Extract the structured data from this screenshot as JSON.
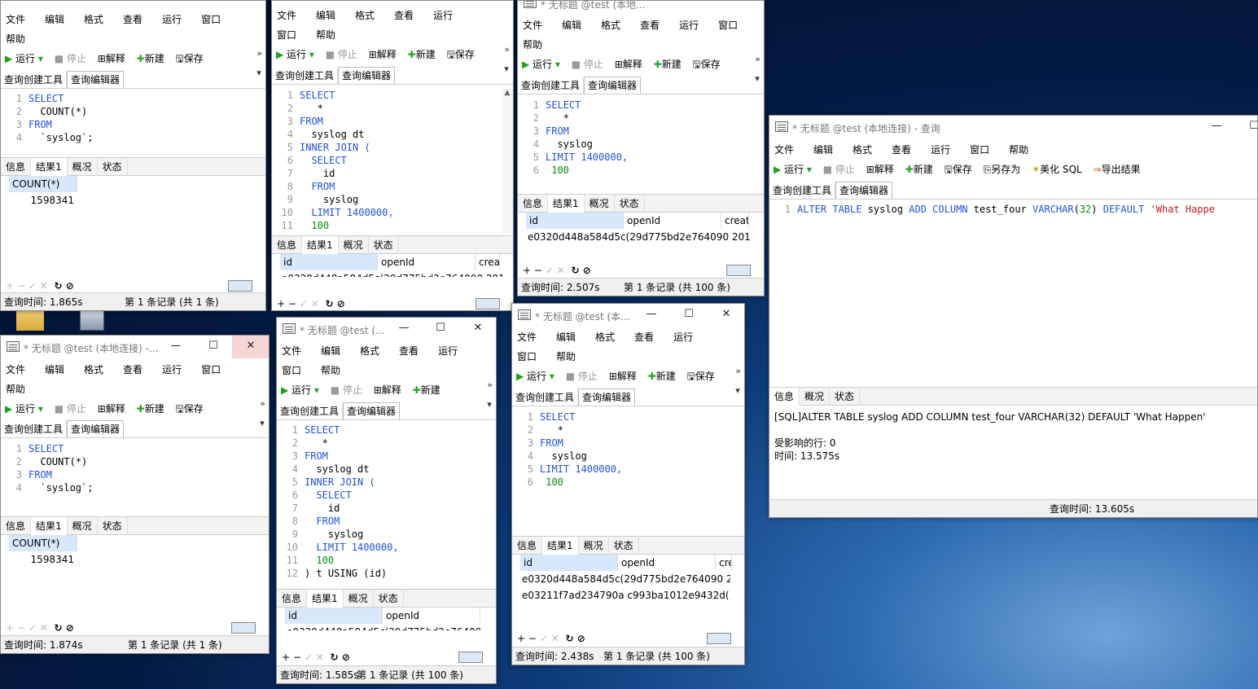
{
  "menus_a": [
    "文件",
    "编辑",
    "格式",
    "查看",
    "运行",
    "窗口",
    "帮助"
  ],
  "toolbar_a": {
    "run": "运行",
    "stop": "停止",
    "explain": "解释",
    "new": "新建",
    "save": "保存"
  },
  "toolbar_e": {
    "run": "运行",
    "stop": "停止",
    "explain": "解释",
    "new": "新建",
    "save": "保存",
    "saveas": "另存为",
    "beautify": "美化 SQL",
    "export": "导出结果"
  },
  "tabs": {
    "builder": "查询创建工具",
    "editor": "查询编辑器"
  },
  "result_tabs": {
    "info": "信息",
    "result1": "结果1",
    "profile": "概况",
    "status": "状态"
  },
  "win_count": {
    "code": [
      {
        "n": "1",
        "a": "SELECT",
        "b": ""
      },
      {
        "n": "2",
        "a": "",
        "b": "  COUNT(*)"
      },
      {
        "n": "3",
        "a": "FROM",
        "b": ""
      },
      {
        "n": "4",
        "a": "",
        "b": "  `syslog`;"
      }
    ],
    "col": "COUNT(*)",
    "val": "1598341"
  },
  "win1": {
    "title": "",
    "time": "查询时间: 1.865s",
    "records": "第 1 条记录 (共 1 条)"
  },
  "win2": {
    "title": "* 无标题 @test (本地连接) -...",
    "time": "查询时间: 1.874s",
    "records": "第 1 条记录 (共 1 条)"
  },
  "win3": {
    "code": [
      {
        "n": "1",
        "t": "SELECT"
      },
      {
        "n": "2",
        "t": "   *"
      },
      {
        "n": "3",
        "t": "FROM"
      },
      {
        "n": "4",
        "t": "  syslog dt"
      },
      {
        "n": "5",
        "t": "INNER JOIN ("
      },
      {
        "n": "6",
        "t": "  SELECT"
      },
      {
        "n": "7",
        "t": "    id"
      },
      {
        "n": "8",
        "t": "  FROM"
      },
      {
        "n": "9",
        "t": "    syslog"
      },
      {
        "n": "10",
        "t": "  LIMIT 1400000,"
      },
      {
        "n": "11",
        "t": "  100"
      }
    ],
    "cols": [
      "id",
      "openId",
      "crea"
    ],
    "row": "e0320d448a584d5c(29d775bd2e764090 2019"
  },
  "win4": {
    "title": "* 无标题 @test (...",
    "code": [
      {
        "n": "1",
        "t": "SELECT"
      },
      {
        "n": "2",
        "t": "   *"
      },
      {
        "n": "3",
        "t": "FROM"
      },
      {
        "n": "4",
        "t": "  syslog dt"
      },
      {
        "n": "5",
        "t": "INNER JOIN ("
      },
      {
        "n": "6",
        "t": "  SELECT"
      },
      {
        "n": "7",
        "t": "    id"
      },
      {
        "n": "8",
        "t": "  FROM"
      },
      {
        "n": "9",
        "t": "    syslog"
      },
      {
        "n": "10",
        "t": "  LIMIT 1400000,"
      },
      {
        "n": "11",
        "t": "  100"
      },
      {
        "n": "12",
        "t": ") t USING (id)"
      }
    ],
    "cols": [
      "id",
      "openId"
    ],
    "row": "e0320d448a584d5c(29d775bd2e764090",
    "time": "查询时间: 1.585s",
    "records": "第 1 条记录 (共 100 条)"
  },
  "win5": {
    "title": "* 无标题 @test (本地...",
    "code": [
      {
        "n": "1",
        "t": "SELECT"
      },
      {
        "n": "2",
        "t": "   *"
      },
      {
        "n": "3",
        "t": "FROM"
      },
      {
        "n": "4",
        "t": "  syslog"
      },
      {
        "n": "5",
        "t": "LIMIT 1400000,"
      },
      {
        "n": "6",
        "t": " 100"
      }
    ],
    "cols": [
      "id",
      "openId",
      "creat"
    ],
    "row": "e0320d448a584d5c(29d775bd2e764090 2019-",
    "time": "查询时间: 2.507s",
    "records": "第 1 条记录 (共 100 条)"
  },
  "win6": {
    "title": "* 无标题 @test (本...",
    "code": [
      {
        "n": "1",
        "t": "SELECT"
      },
      {
        "n": "2",
        "t": "   *"
      },
      {
        "n": "3",
        "t": "FROM"
      },
      {
        "n": "4",
        "t": "  syslog"
      },
      {
        "n": "5",
        "t": "LIMIT 1400000,"
      },
      {
        "n": "6",
        "t": " 100"
      }
    ],
    "cols": [
      "id",
      "openId",
      "cre"
    ],
    "row1": "e0320d448a584d5c(29d775bd2e764090 20",
    "row2": "e03211f7ad234790a c993ba1012e9432d( 20",
    "time": "查询时间: 2.438s",
    "records": "第 1 条记录 (共 100 条)"
  },
  "win7": {
    "title": "* 无标题 @test (本地连接) - 查询",
    "sql_a": "ALTER TABLE",
    "sql_b": " syslog ",
    "sql_c": "ADD COLUMN",
    "sql_d": " test_four ",
    "sql_e": "VARCHAR",
    "sql_f": "(",
    "sql_g": "32",
    "sql_h": ") ",
    "sql_i": "DEFAULT",
    "sql_j": " 'What Happe",
    "info_line": "[SQL]ALTER TABLE syslog ADD COLUMN test_four VARCHAR(32) DEFAULT 'What Happen'",
    "affected": "受影响的行: 0",
    "elapsed": "时间: 13.575s",
    "query_time": "查询时间: 13.605s"
  }
}
